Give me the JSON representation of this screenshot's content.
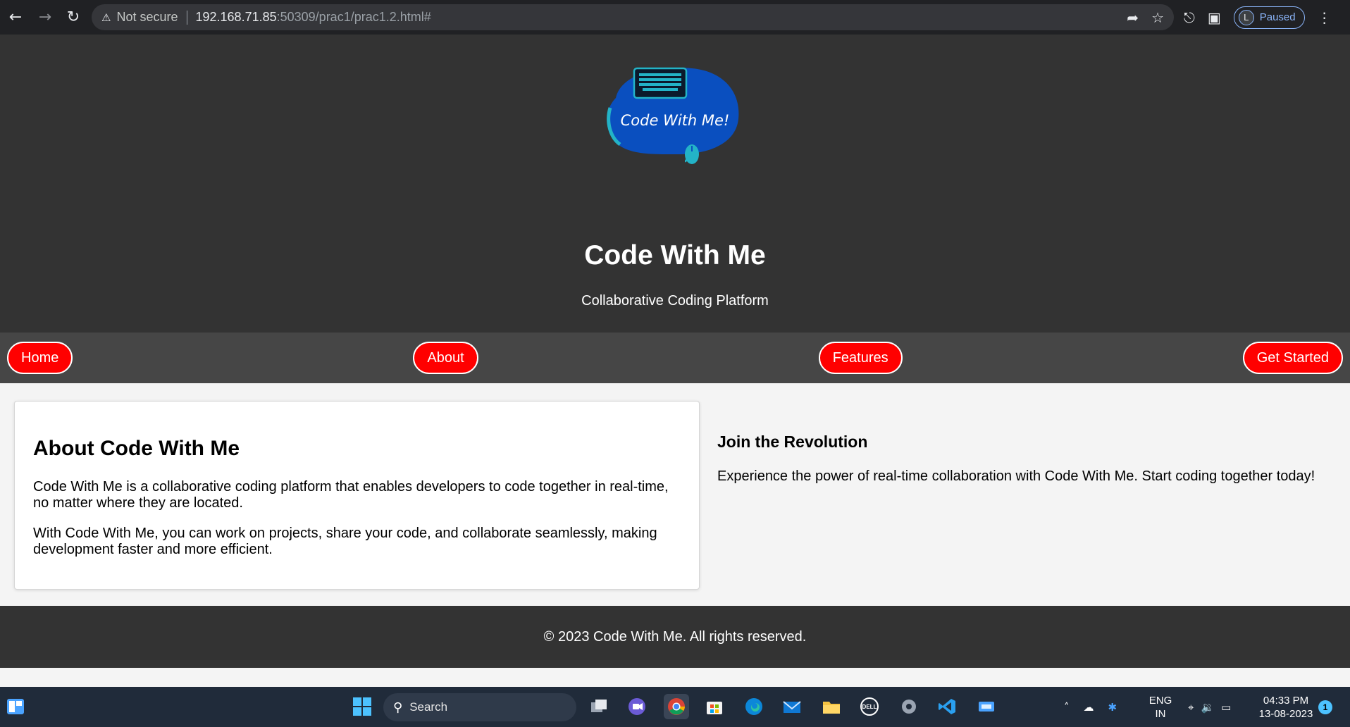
{
  "browser": {
    "security_label": "Not secure",
    "url_host": "192.168.71.85",
    "url_rest": ":50309/prac1/prac1.2.html#",
    "profile_initial": "L",
    "profile_status": "Paused"
  },
  "logo": {
    "text": "Code With Me!",
    "colors": {
      "blob": "#0a4fbf",
      "accent": "#23b3c7"
    }
  },
  "header": {
    "title": "Code With Me",
    "subtitle": "Collaborative Coding Platform"
  },
  "nav": {
    "items": [
      {
        "label": "Home"
      },
      {
        "label": "About"
      },
      {
        "label": "Features"
      },
      {
        "label": "Get Started"
      }
    ],
    "colors": {
      "pill": "#ff0000",
      "bar": "#464646"
    }
  },
  "about": {
    "heading": "About Code With Me",
    "para1": "Code With Me is a collaborative coding platform that enables developers to code together in real-time, no matter where they are located.",
    "para2": "With Code With Me, you can work on projects, share your code, and collaborate seamlessly, making development faster and more efficient."
  },
  "join": {
    "heading": "Join the Revolution",
    "text": "Experience the power of real-time collaboration with Code With Me. Start coding together today!"
  },
  "footer": {
    "text": "© 2023 Code With Me. All rights reserved."
  },
  "taskbar": {
    "search_label": "Search",
    "lang_line1": "ENG",
    "lang_line2": "IN",
    "time": "04:33 PM",
    "date": "13-08-2023",
    "notification_count": "1"
  }
}
